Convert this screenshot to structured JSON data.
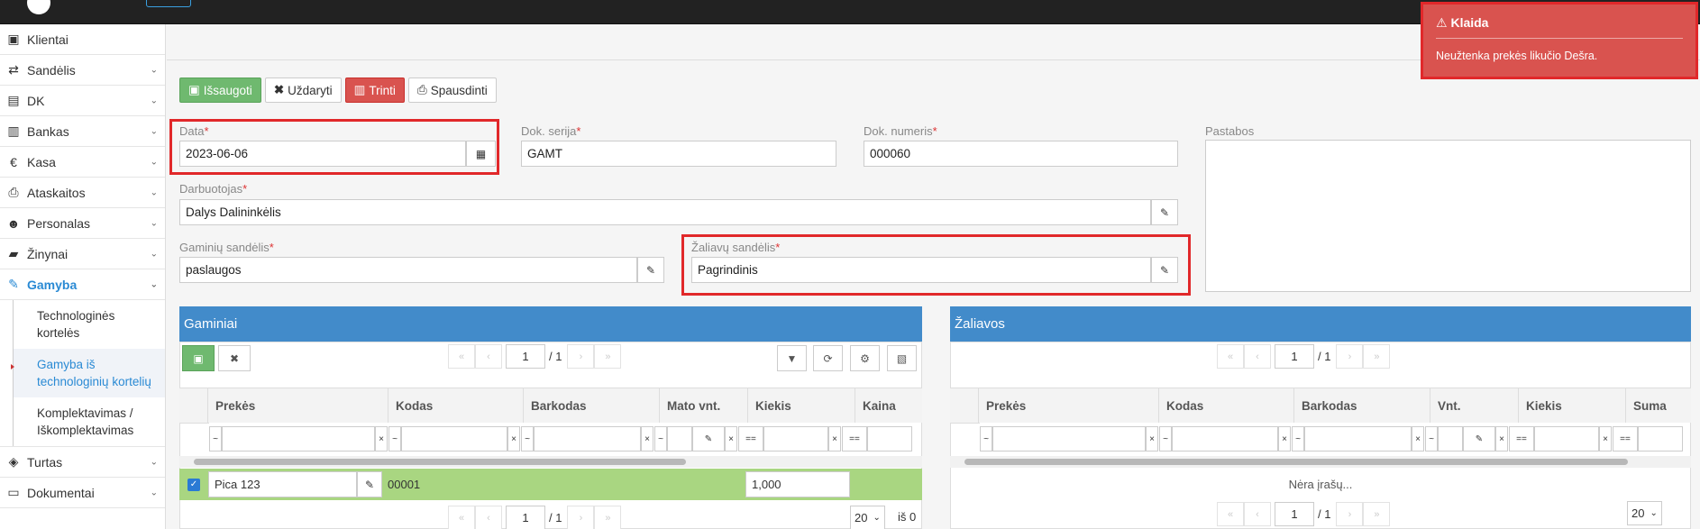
{
  "sidebar": {
    "items": [
      {
        "label": "Klientai",
        "icon": "id-card-icon"
      },
      {
        "label": "Sandėlis",
        "icon": "exchange-icon"
      },
      {
        "label": "DK",
        "icon": "book-icon"
      },
      {
        "label": "Bankas",
        "icon": "bank-icon"
      },
      {
        "label": "Kasa",
        "icon": "euro-icon"
      },
      {
        "label": "Ataskaitos",
        "icon": "print-icon"
      },
      {
        "label": "Personalas",
        "icon": "users-icon"
      },
      {
        "label": "Žinynai",
        "icon": "folder-open-icon"
      },
      {
        "label": "Gamyba",
        "icon": "wrench-icon"
      }
    ],
    "subitems": [
      "Technologinės kortelės",
      "Gamyba iš technologinių kortelių",
      "Komplektavimas / Iškomplektavimas"
    ],
    "bottom_items": [
      {
        "label": "Turtas",
        "icon": "cube-icon"
      },
      {
        "label": "Dokumentai",
        "icon": "inbox-icon"
      }
    ]
  },
  "toolbar": {
    "save": "Išsaugoti",
    "close": "Uždaryti",
    "delete": "Trinti",
    "print": "Spausdinti"
  },
  "form": {
    "date_label": "Data",
    "date_value": "2023-06-06",
    "series_label": "Dok. serija",
    "series_value": "GAMT",
    "number_label": "Dok. numeris",
    "number_value": "000060",
    "notes_label": "Pastabos",
    "employee_label": "Darbuotojas",
    "employee_value": "Dalys Dalininkėlis",
    "products_wh_label": "Gaminių sandėlis",
    "products_wh_value": "paslaugos",
    "raw_wh_label": "Žaliavų sandėlis",
    "raw_wh_value": "Pagrindinis",
    "required_mark": "*"
  },
  "products_panel": {
    "title": "Gaminiai",
    "page": "1",
    "page_total": "/ 1",
    "columns": [
      "Prekės",
      "Kodas",
      "Barkodas",
      "Mato vnt.",
      "Kiekis",
      "Kaina"
    ],
    "rows": [
      {
        "product": "Pica 123",
        "code": "00001",
        "barcode": "",
        "unit": "",
        "qty": "1,000",
        "price": ""
      }
    ],
    "page_size": "20",
    "of_text": "iš 0"
  },
  "materials_panel": {
    "title": "Žaliavos",
    "page": "1",
    "page_total": "/ 1",
    "columns": [
      "Prekės",
      "Kodas",
      "Barkodas",
      "Vnt.",
      "Kiekis",
      "Suma"
    ],
    "empty_text": "Nėra įrašų...",
    "page_size": "20"
  },
  "toast": {
    "title": "Klaida",
    "message": "Neužtenka prekės likučio Dešra."
  },
  "filters": {
    "like": "~",
    "eq": "==",
    "clear": "×"
  },
  "colors": {
    "accent": "#428bca",
    "danger": "#d9534f",
    "success": "#6fb96f",
    "selected_row": "#a9d681"
  }
}
